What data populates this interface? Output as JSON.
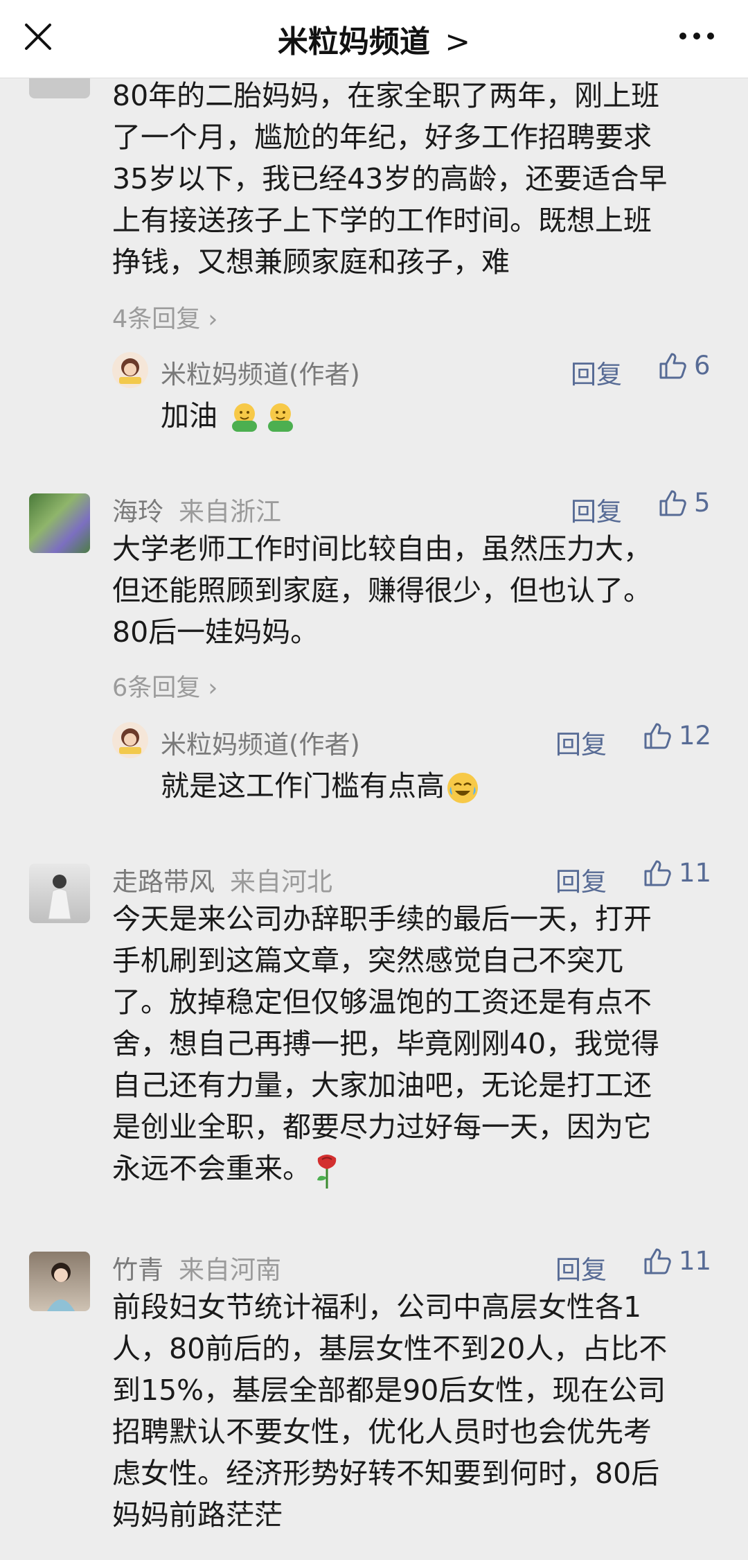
{
  "header": {
    "title": "米粒妈频道",
    "chevron": ">",
    "close_icon": "close-icon",
    "more_icon": "more-icon"
  },
  "comments": [
    {
      "name": "",
      "location": "",
      "text_lines": [
        "80年的二胎妈妈，在家全职了两年，刚上班",
        "了一个月，尴尬的年纪，好多工作招聘要求",
        "35岁以下，我已经43岁的高龄，还要适合早",
        "上有接送孩子上下学的工作时间。既想上班",
        "挣钱，又想兼顾家庭和孩子，难"
      ],
      "reply_count": "4条回复",
      "author_reply": {
        "name": "米粒妈频道(作者)",
        "reply_label": "回复",
        "likes": "6",
        "text": "加油",
        "emoji": [
          "hug-emoji",
          "hug-emoji"
        ]
      }
    },
    {
      "name": "海玲",
      "location": "来自浙江",
      "reply_label": "回复",
      "likes": "5",
      "text_lines": [
        "大学老师工作时间比较自由，虽然压力大，",
        "但还能照顾到家庭，赚得很少，但也认了。",
        "80后一娃妈妈。"
      ],
      "reply_count": "6条回复",
      "author_reply": {
        "name": "米粒妈频道(作者)",
        "reply_label": "回复",
        "likes": "12",
        "text": "就是这工作门槛有点高",
        "emoji": [
          "crying-laughing-emoji"
        ]
      }
    },
    {
      "name": "走路带风",
      "location": "来自河北",
      "reply_label": "回复",
      "likes": "11",
      "text_lines": [
        "今天是来公司办辞职手续的最后一天，打开",
        "手机刷到这篇文章，突然感觉自己不突兀",
        "了。放掉稳定但仅够温饱的工资还是有点不",
        "舍，想自己再搏一把，毕竟刚刚40，我觉得",
        "自己还有力量，大家加油吧，无论是打工还",
        "是创业全职，都要尽力过好每一天，因为它",
        "永远不会重来。"
      ],
      "emoji": "rose-emoji"
    },
    {
      "name": "竹青",
      "location": "来自河南",
      "reply_label": "回复",
      "likes": "11",
      "text_lines": [
        "前段妇女节统计福利，公司中高层女性各1",
        "人，80前后的，基层女性不到20人，占比不",
        "到15%，基层全部都是90后女性，现在公司",
        "招聘默认不要女性，优化人员时也会优先考",
        "虑女性。经济形势好转不知要到何时，80后",
        "妈妈前路茫茫"
      ]
    }
  ],
  "colors": {
    "background": "#ededed",
    "link_blue": "#576b95",
    "name_gray": "#7a7a7a"
  }
}
